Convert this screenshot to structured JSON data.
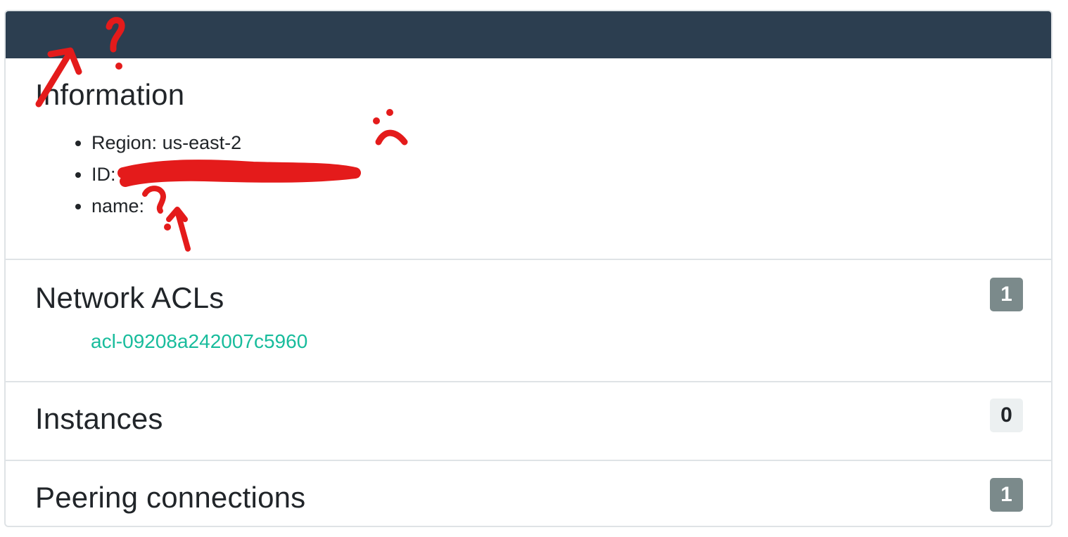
{
  "information": {
    "title": "Information",
    "region": "Region: us-east-2",
    "id_label": "ID:",
    "name_label": "name:"
  },
  "network_acls": {
    "title": "Network ACLs",
    "count": "1",
    "items": [
      "acl-09208a242007c5960"
    ]
  },
  "instances": {
    "title": "Instances",
    "count": "0"
  },
  "peering_connections": {
    "title": "Peering connections",
    "count": "1"
  },
  "colors": {
    "header": "#2c3e50",
    "link": "#18bc9c",
    "badge_dark": "#7b8a8b",
    "badge_light": "#ecf0f1",
    "annotation": "#e41b1b"
  }
}
